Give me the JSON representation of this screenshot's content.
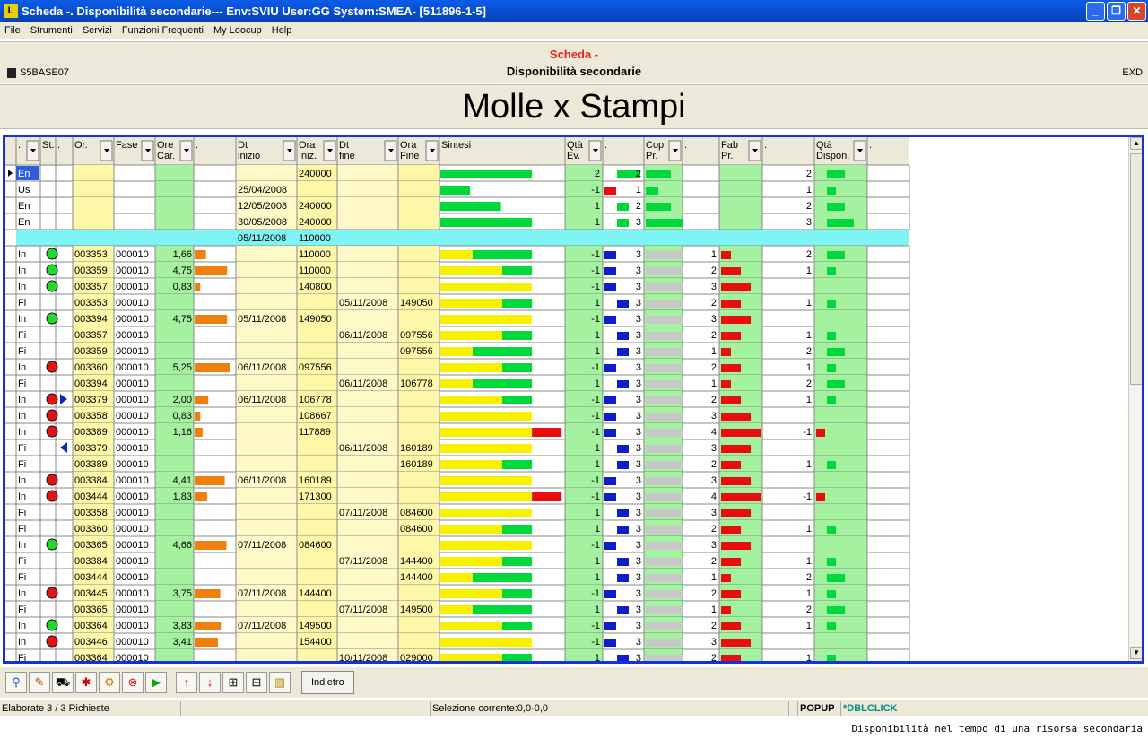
{
  "window": {
    "title": "Scheda -. Disponibilità secondarie--- Env:SVIU User:GG System:SMEA- [511896-1-5]"
  },
  "menu": [
    "File",
    "Strumenti",
    "Servizi",
    "Funzioni Frequenti",
    "My Loocup",
    "Help"
  ],
  "header": {
    "title": "Scheda -",
    "subtitle": "Disponibilità secondarie",
    "code_left": "S5BASE07",
    "code_right": "EXD"
  },
  "banner": "Molle x Stampi",
  "grid": {
    "columns": [
      {
        "label": ".",
        "dropdown": true
      },
      {
        "label": "St.",
        "dropdown": false
      },
      {
        "label": ".",
        "dropdown": false
      },
      {
        "label": "Or.",
        "dropdown": true
      },
      {
        "label": "Fase",
        "dropdown": true
      },
      {
        "label": "Ore Car.",
        "dropdown": true
      },
      {
        "label": ".",
        "dropdown": false
      },
      {
        "label": "Dt inizio",
        "dropdown": true
      },
      {
        "label": "Ora Iniz.",
        "dropdown": true
      },
      {
        "label": "Dt fine",
        "dropdown": true
      },
      {
        "label": "Ora Fine",
        "dropdown": true
      },
      {
        "label": "Sintesi",
        "dropdown": false
      },
      {
        "label": "Qtà Ev.",
        "dropdown": true
      },
      {
        "label": ".",
        "dropdown": false
      },
      {
        "label": "Cop Pr.",
        "dropdown": true
      },
      {
        "label": ".",
        "dropdown": false
      },
      {
        "label": "Fab Pr.",
        "dropdown": true
      },
      {
        "label": ".",
        "dropdown": false
      },
      {
        "label": "Qtà Dispon.",
        "dropdown": true
      },
      {
        "label": ".",
        "dropdown": false
      }
    ],
    "rows": [
      {
        "type": "En",
        "st": "",
        "arrow": "",
        "or": "",
        "fase": "",
        "ore": "",
        "dt_ini": "",
        "ora_ini": "240000",
        "dt_fine": "",
        "ora_fine": "",
        "syn_y": 0,
        "syn_g": 0.74,
        "syn_r": 0,
        "qta": "2",
        "cop": "2",
        "fab": "",
        "disp": "2",
        "sel": true
      },
      {
        "type": "Us",
        "st": "",
        "arrow": "",
        "or": "",
        "fase": "",
        "ore": "",
        "dt_ini": "25/04/2008",
        "ora_ini": "",
        "dt_fine": "",
        "ora_fine": "",
        "syn_y": 0,
        "syn_g": 0.24,
        "syn_r": 0,
        "qta": "-1",
        "cop": "1",
        "fab": "",
        "disp": "1"
      },
      {
        "type": "En",
        "st": "",
        "arrow": "",
        "or": "",
        "fase": "",
        "ore": "",
        "dt_ini": "12/05/2008",
        "ora_ini": "240000",
        "dt_fine": "",
        "ora_fine": "",
        "syn_y": 0,
        "syn_g": 0.49,
        "syn_r": 0,
        "qta": "1",
        "cop": "2",
        "fab": "",
        "disp": "2"
      },
      {
        "type": "En",
        "st": "",
        "arrow": "",
        "or": "",
        "fase": "",
        "ore": "",
        "dt_ini": "30/05/2008",
        "ora_ini": "240000",
        "dt_fine": "",
        "ora_fine": "",
        "syn_y": 0,
        "syn_g": 0.74,
        "syn_r": 0,
        "qta": "1",
        "cop": "3",
        "fab": "",
        "disp": "3"
      },
      {
        "type": "",
        "st": "",
        "arrow": "",
        "or": "",
        "fase": "",
        "ore": "",
        "dt_ini": "05/11/2008",
        "ora_ini": "110000",
        "dt_fine": "",
        "ora_fine": "",
        "syn_y": 0,
        "syn_g": 0,
        "syn_r": 0,
        "qta": "",
        "cop": "",
        "fab": "",
        "disp": "",
        "band": true
      },
      {
        "type": "In",
        "st": "green",
        "arrow": "",
        "or": "003353",
        "fase": "000010",
        "ore": "1,66",
        "dt_ini": "",
        "ora_ini": "110000",
        "dt_fine": "",
        "ora_fine": "",
        "syn_y": 0.26,
        "syn_g": 0.48,
        "syn_r": 0,
        "qta": "-1",
        "cop": "3",
        "fab": "1",
        "disp": "2"
      },
      {
        "type": "In",
        "st": "green",
        "arrow": "",
        "or": "003359",
        "fase": "000010",
        "ore": "4,75",
        "dt_ini": "",
        "ora_ini": "110000",
        "dt_fine": "",
        "ora_fine": "",
        "syn_y": 0.5,
        "syn_g": 0.24,
        "syn_r": 0,
        "qta": "-1",
        "cop": "3",
        "fab": "2",
        "disp": "1"
      },
      {
        "type": "In",
        "st": "green",
        "arrow": "",
        "or": "003357",
        "fase": "000010",
        "ore": "0,83",
        "dt_ini": "",
        "ora_ini": "140800",
        "dt_fine": "",
        "ora_fine": "",
        "syn_y": 0.74,
        "syn_g": 0,
        "syn_r": 0,
        "qta": "-1",
        "cop": "3",
        "fab": "3",
        "disp": ""
      },
      {
        "type": "Fi",
        "st": "",
        "arrow": "",
        "or": "003353",
        "fase": "000010",
        "ore": "",
        "dt_ini": "",
        "ora_ini": "",
        "dt_fine": "05/11/2008",
        "ora_fine": "149050",
        "syn_y": 0.5,
        "syn_g": 0.24,
        "syn_r": 0,
        "qta": "1",
        "cop": "3",
        "fab": "2",
        "disp": "1"
      },
      {
        "type": "In",
        "st": "green",
        "arrow": "",
        "or": "003394",
        "fase": "000010",
        "ore": "4,75",
        "dt_ini": "05/11/2008",
        "ora_ini": "149050",
        "dt_fine": "",
        "ora_fine": "",
        "syn_y": 0.74,
        "syn_g": 0,
        "syn_r": 0,
        "qta": "-1",
        "cop": "3",
        "fab": "3",
        "disp": ""
      },
      {
        "type": "Fi",
        "st": "",
        "arrow": "",
        "or": "003357",
        "fase": "000010",
        "ore": "",
        "dt_ini": "",
        "ora_ini": "",
        "dt_fine": "06/11/2008",
        "ora_fine": "097556",
        "syn_y": 0.5,
        "syn_g": 0.24,
        "syn_r": 0,
        "qta": "1",
        "cop": "3",
        "fab": "2",
        "disp": "1"
      },
      {
        "type": "Fi",
        "st": "",
        "arrow": "",
        "or": "003359",
        "fase": "000010",
        "ore": "",
        "dt_ini": "",
        "ora_ini": "",
        "dt_fine": "",
        "ora_fine": "097556",
        "syn_y": 0.26,
        "syn_g": 0.48,
        "syn_r": 0,
        "qta": "1",
        "cop": "3",
        "fab": "1",
        "disp": "2"
      },
      {
        "type": "In",
        "st": "red",
        "arrow": "",
        "or": "003360",
        "fase": "000010",
        "ore": "5,25",
        "dt_ini": "06/11/2008",
        "ora_ini": "097556",
        "dt_fine": "",
        "ora_fine": "",
        "syn_y": 0.5,
        "syn_g": 0.24,
        "syn_r": 0,
        "qta": "-1",
        "cop": "3",
        "fab": "2",
        "disp": "1"
      },
      {
        "type": "Fi",
        "st": "",
        "arrow": "",
        "or": "003394",
        "fase": "000010",
        "ore": "",
        "dt_ini": "",
        "ora_ini": "",
        "dt_fine": "06/11/2008",
        "ora_fine": "106778",
        "syn_y": 0.26,
        "syn_g": 0.48,
        "syn_r": 0,
        "qta": "1",
        "cop": "3",
        "fab": "1",
        "disp": "2"
      },
      {
        "type": "In",
        "st": "red",
        "arrow": "right",
        "or": "003379",
        "fase": "000010",
        "ore": "2,00",
        "dt_ini": "06/11/2008",
        "ora_ini": "106778",
        "dt_fine": "",
        "ora_fine": "",
        "syn_y": 0.5,
        "syn_g": 0.24,
        "syn_r": 0,
        "qta": "-1",
        "cop": "3",
        "fab": "2",
        "disp": "1"
      },
      {
        "type": "In",
        "st": "red",
        "arrow": "",
        "or": "003358",
        "fase": "000010",
        "ore": "0,83",
        "dt_ini": "",
        "ora_ini": "108667",
        "dt_fine": "",
        "ora_fine": "",
        "syn_y": 0.74,
        "syn_g": 0,
        "syn_r": 0,
        "qta": "-1",
        "cop": "3",
        "fab": "3",
        "disp": ""
      },
      {
        "type": "In",
        "st": "red",
        "arrow": "",
        "or": "003389",
        "fase": "000010",
        "ore": "1,16",
        "dt_ini": "",
        "ora_ini": "117889",
        "dt_fine": "",
        "ora_fine": "",
        "syn_y": 0.74,
        "syn_g": 0,
        "syn_r": 0.24,
        "qta": "-1",
        "cop": "3",
        "fab": "4",
        "disp": "-1"
      },
      {
        "type": "Fi",
        "st": "",
        "arrow": "left",
        "or": "003379",
        "fase": "000010",
        "ore": "",
        "dt_ini": "",
        "ora_ini": "",
        "dt_fine": "06/11/2008",
        "ora_fine": "160189",
        "syn_y": 0.74,
        "syn_g": 0,
        "syn_r": 0,
        "qta": "1",
        "cop": "3",
        "fab": "3",
        "disp": ""
      },
      {
        "type": "Fi",
        "st": "",
        "arrow": "",
        "or": "003389",
        "fase": "000010",
        "ore": "",
        "dt_ini": "",
        "ora_ini": "",
        "dt_fine": "",
        "ora_fine": "160189",
        "syn_y": 0.5,
        "syn_g": 0.24,
        "syn_r": 0,
        "qta": "1",
        "cop": "3",
        "fab": "2",
        "disp": "1"
      },
      {
        "type": "In",
        "st": "red",
        "arrow": "",
        "or": "003384",
        "fase": "000010",
        "ore": "4,41",
        "dt_ini": "06/11/2008",
        "ora_ini": "160189",
        "dt_fine": "",
        "ora_fine": "",
        "syn_y": 0.74,
        "syn_g": 0,
        "syn_r": 0,
        "qta": "-1",
        "cop": "3",
        "fab": "3",
        "disp": ""
      },
      {
        "type": "In",
        "st": "red",
        "arrow": "",
        "or": "003444",
        "fase": "000010",
        "ore": "1,83",
        "dt_ini": "",
        "ora_ini": "171300",
        "dt_fine": "",
        "ora_fine": "",
        "syn_y": 0.74,
        "syn_g": 0,
        "syn_r": 0.24,
        "qta": "-1",
        "cop": "3",
        "fab": "4",
        "disp": "-1"
      },
      {
        "type": "Fi",
        "st": "",
        "arrow": "",
        "or": "003358",
        "fase": "000010",
        "ore": "",
        "dt_ini": "",
        "ora_ini": "",
        "dt_fine": "07/11/2008",
        "ora_fine": "084600",
        "syn_y": 0.74,
        "syn_g": 0,
        "syn_r": 0,
        "qta": "1",
        "cop": "3",
        "fab": "3",
        "disp": ""
      },
      {
        "type": "Fi",
        "st": "",
        "arrow": "",
        "or": "003360",
        "fase": "000010",
        "ore": "",
        "dt_ini": "",
        "ora_ini": "",
        "dt_fine": "",
        "ora_fine": "084600",
        "syn_y": 0.5,
        "syn_g": 0.24,
        "syn_r": 0,
        "qta": "1",
        "cop": "3",
        "fab": "2",
        "disp": "1"
      },
      {
        "type": "In",
        "st": "green",
        "arrow": "",
        "or": "003365",
        "fase": "000010",
        "ore": "4,66",
        "dt_ini": "07/11/2008",
        "ora_ini": "084600",
        "dt_fine": "",
        "ora_fine": "",
        "syn_y": 0.74,
        "syn_g": 0,
        "syn_r": 0,
        "qta": "-1",
        "cop": "3",
        "fab": "3",
        "disp": ""
      },
      {
        "type": "Fi",
        "st": "",
        "arrow": "",
        "or": "003384",
        "fase": "000010",
        "ore": "",
        "dt_ini": "",
        "ora_ini": "",
        "dt_fine": "07/11/2008",
        "ora_fine": "144400",
        "syn_y": 0.5,
        "syn_g": 0.24,
        "syn_r": 0,
        "qta": "1",
        "cop": "3",
        "fab": "2",
        "disp": "1"
      },
      {
        "type": "Fi",
        "st": "",
        "arrow": "",
        "or": "003444",
        "fase": "000010",
        "ore": "",
        "dt_ini": "",
        "ora_ini": "",
        "dt_fine": "",
        "ora_fine": "144400",
        "syn_y": 0.26,
        "syn_g": 0.48,
        "syn_r": 0,
        "qta": "1",
        "cop": "3",
        "fab": "1",
        "disp": "2"
      },
      {
        "type": "In",
        "st": "red",
        "arrow": "",
        "or": "003445",
        "fase": "000010",
        "ore": "3,75",
        "dt_ini": "07/11/2008",
        "ora_ini": "144400",
        "dt_fine": "",
        "ora_fine": "",
        "syn_y": 0.5,
        "syn_g": 0.24,
        "syn_r": 0,
        "qta": "-1",
        "cop": "3",
        "fab": "2",
        "disp": "1"
      },
      {
        "type": "Fi",
        "st": "",
        "arrow": "",
        "or": "003365",
        "fase": "000010",
        "ore": "",
        "dt_ini": "",
        "ora_ini": "",
        "dt_fine": "07/11/2008",
        "ora_fine": "149500",
        "syn_y": 0.26,
        "syn_g": 0.48,
        "syn_r": 0,
        "qta": "1",
        "cop": "3",
        "fab": "1",
        "disp": "2"
      },
      {
        "type": "In",
        "st": "green",
        "arrow": "",
        "or": "003364",
        "fase": "000010",
        "ore": "3,83",
        "dt_ini": "07/11/2008",
        "ora_ini": "149500",
        "dt_fine": "",
        "ora_fine": "",
        "syn_y": 0.5,
        "syn_g": 0.24,
        "syn_r": 0,
        "qta": "-1",
        "cop": "3",
        "fab": "2",
        "disp": "1"
      },
      {
        "type": "In",
        "st": "red",
        "arrow": "",
        "or": "003446",
        "fase": "000010",
        "ore": "3,41",
        "dt_ini": "",
        "ora_ini": "154400",
        "dt_fine": "",
        "ora_fine": "",
        "syn_y": 0.74,
        "syn_g": 0,
        "syn_r": 0,
        "qta": "-1",
        "cop": "3",
        "fab": "3",
        "disp": ""
      },
      {
        "type": "Fi",
        "st": "",
        "arrow": "",
        "or": "003364",
        "fase": "000010",
        "ore": "",
        "dt_ini": "",
        "ora_ini": "",
        "dt_fine": "10/11/2008",
        "ora_fine": "029000",
        "syn_y": 0.5,
        "syn_g": 0.24,
        "syn_r": 0,
        "qta": "1",
        "cop": "3",
        "fab": "2",
        "disp": "1"
      }
    ]
  },
  "toolbar": {
    "icons": [
      "search-icon",
      "edit-icon",
      "cart-icon",
      "star-icon",
      "zoom-icon",
      "stop-icon",
      "play-icon",
      "arrow-up-icon",
      "arrow-down-icon",
      "tree-icon",
      "table-icon",
      "columns-icon"
    ],
    "back_label": "Indietro"
  },
  "status": {
    "left": "Elaborate 3 / 3 Richieste",
    "middle": "Selezione corrente:0,0-0,0",
    "popup": "POPUP",
    "dblclick": "*DBLCLICK"
  },
  "caption": "Disponibilità nel tempo di una risorsa secondaria",
  "colors": {
    "yellow_cell": "#fff7a8",
    "green_cell": "#a4f2a0",
    "band": "#7ff4f4",
    "bar_green": "#00d83c",
    "bar_yellow": "#f7f000",
    "bar_red": "#e80e0e",
    "bar_orange": "#f07f0c",
    "bar_blue": "#0e1ec8",
    "bar_gray": "#c8c8c8",
    "frame_blue": "#1830d8"
  }
}
